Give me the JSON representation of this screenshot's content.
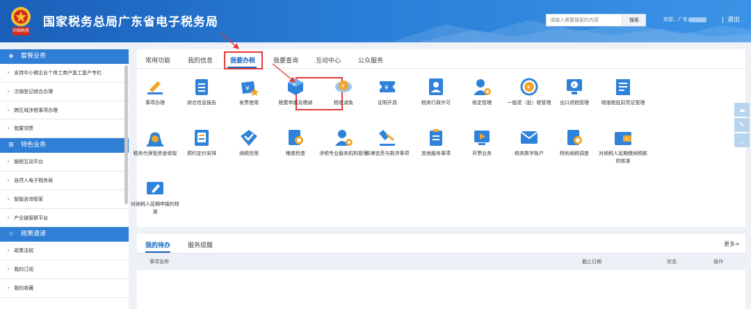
{
  "header": {
    "title": "国家税务总局广东省电子税务局",
    "emblem_text": "中国税务",
    "search_placeholder": "请输入需要搜索的内容",
    "search_button": "搜索",
    "welcome_prefix": "欢迎，广东",
    "logout": "退出"
  },
  "sidebar": {
    "sections": [
      {
        "title": "套餐业务",
        "icon": "layers-icon",
        "items": [
          "支持中小微企业个体工商户复工复产专栏",
          "注销登记综合办理",
          "跨区域涉税事项办理",
          "我要领票"
        ]
      },
      {
        "title": "特色业务",
        "icon": "grid-icon",
        "items": [
          "银税互动平台",
          "自然人电子税务局",
          "智能咨询管家",
          "产业链智联平台"
        ]
      },
      {
        "title": "政策速递",
        "icon": "star-icon",
        "items": [
          "政策法规",
          "我的订阅",
          "我的收藏"
        ]
      }
    ]
  },
  "tabs": [
    "常用功能",
    "我的信息",
    "我要办税",
    "我要查询",
    "互动中心",
    "公众服务"
  ],
  "active_tab": "我要办税",
  "services": [
    {
      "label": "事项办理",
      "icon": "pencil-icon"
    },
    {
      "label": "综合信息报告",
      "icon": "report-icon"
    },
    {
      "label": "发票使用",
      "icon": "invoice-icon"
    },
    {
      "label": "税费申报及缴纳",
      "icon": "cube-yuan-icon"
    },
    {
      "label": "税收减免",
      "icon": "coin-hand-icon"
    },
    {
      "label": "证明开具",
      "icon": "ticket-yuan-icon"
    },
    {
      "label": "税务行政许可",
      "icon": "person-card-icon"
    },
    {
      "label": "核定管理",
      "icon": "person-gear-icon"
    },
    {
      "label": "一般退（抵）税管理",
      "icon": "refund-cycle-icon"
    },
    {
      "label": "出口退税管理",
      "icon": "monitor-yuan-icon"
    },
    {
      "label": "增值税抵扣凭证管理",
      "icon": "receipt-icon"
    },
    {
      "label": "税务代保管资金收取",
      "icon": "money-bag-icon"
    },
    {
      "label": "预约定价安排",
      "icon": "price-doc-icon"
    },
    {
      "label": "纳税信用",
      "icon": "diamond-check-icon"
    },
    {
      "label": "稽查检查",
      "icon": "doc-search-icon"
    },
    {
      "label": "涉税专业服务机构管理",
      "icon": "person-gear-icon"
    },
    {
      "label": "法律追责与救济事项",
      "icon": "gavel-icon"
    },
    {
      "label": "其他服务事项",
      "icon": "clipboard-icon"
    },
    {
      "label": "开票业务",
      "icon": "screen-play-icon"
    },
    {
      "label": "税务数字账户",
      "icon": "mail-account-icon"
    },
    {
      "label": "特别纳税调查",
      "icon": "doc-search-icon"
    },
    {
      "label": "对纳税人延期缴纳税款的核准",
      "icon": "wallet-yuan-icon"
    },
    {
      "label": "对纳税人延期申报的核准",
      "icon": "ticket-pencil-icon"
    }
  ],
  "tasks": {
    "tabs": [
      "我的待办",
      "服务提醒"
    ],
    "more": "更多>",
    "columns": [
      "事项名称",
      "截止日期",
      "状态",
      "操作"
    ]
  },
  "colors": {
    "header": "#2a7fd8",
    "sidebar_head": "#2f7fd6",
    "accent": "#1565c0",
    "highlight": "#e53935",
    "icon_blue": "#2f82d9",
    "icon_orange": "#f0a62a"
  }
}
